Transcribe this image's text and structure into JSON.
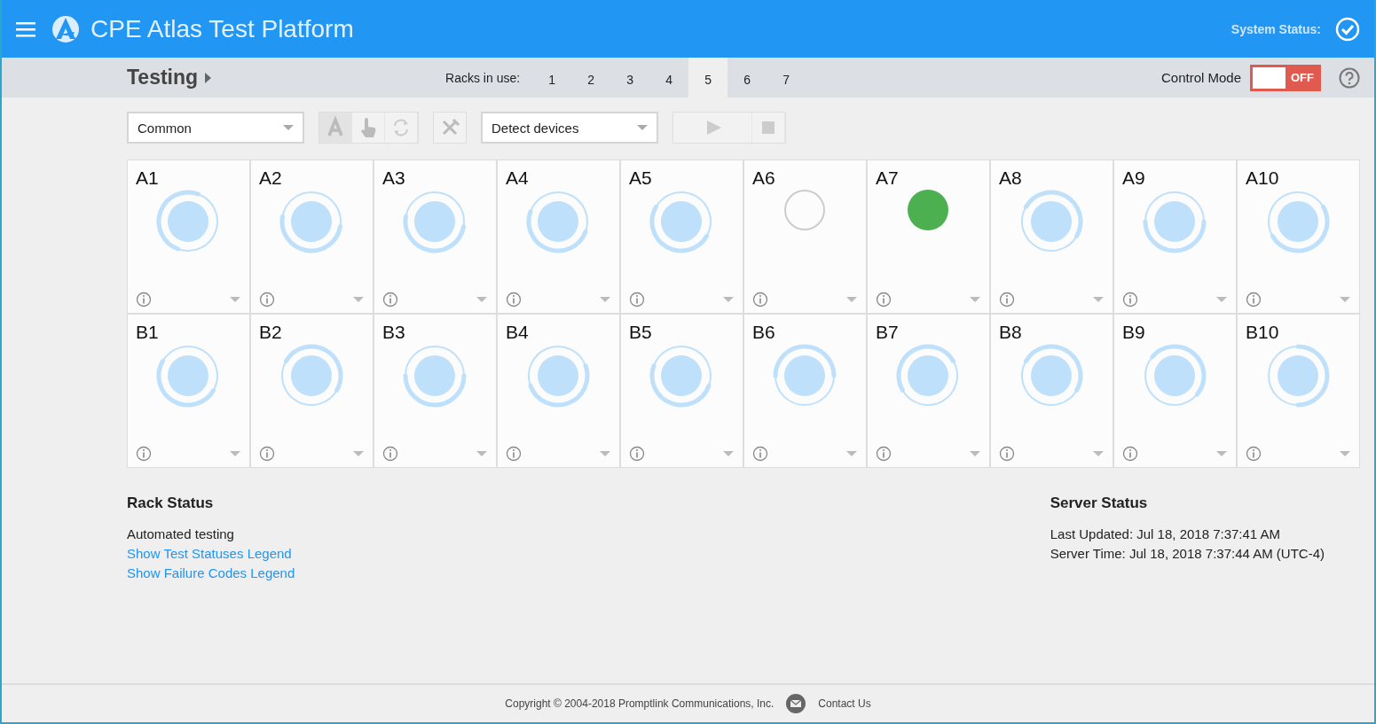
{
  "header": {
    "title": "CPE Atlas Test Platform",
    "system_status_label": "System Status:"
  },
  "subbar": {
    "title": "Testing",
    "racks_label": "Racks in use:",
    "racks": [
      {
        "label": "1",
        "selected": false
      },
      {
        "label": "2",
        "selected": false
      },
      {
        "label": "3",
        "selected": false
      },
      {
        "label": "4",
        "selected": false
      },
      {
        "label": "5",
        "selected": true
      },
      {
        "label": "6",
        "selected": false
      },
      {
        "label": "7",
        "selected": false
      }
    ],
    "control_mode": {
      "label": "Control Mode",
      "on": false,
      "state_text": "OFF"
    }
  },
  "toolbar": {
    "profile_select": {
      "value": "Common"
    },
    "action_select": {
      "value": "Detect devices"
    }
  },
  "slots": [
    {
      "label": "A1",
      "kind": "busy"
    },
    {
      "label": "A2",
      "kind": "busy"
    },
    {
      "label": "A3",
      "kind": "busy"
    },
    {
      "label": "A4",
      "kind": "busy"
    },
    {
      "label": "A5",
      "kind": "busy"
    },
    {
      "label": "A6",
      "kind": "idle"
    },
    {
      "label": "A7",
      "kind": "pass"
    },
    {
      "label": "A8",
      "kind": "busy"
    },
    {
      "label": "A9",
      "kind": "busy"
    },
    {
      "label": "A10",
      "kind": "busy"
    },
    {
      "label": "B1",
      "kind": "busy"
    },
    {
      "label": "B2",
      "kind": "busy"
    },
    {
      "label": "B3",
      "kind": "busy"
    },
    {
      "label": "B4",
      "kind": "busy"
    },
    {
      "label": "B5",
      "kind": "busy"
    },
    {
      "label": "B6",
      "kind": "busy"
    },
    {
      "label": "B7",
      "kind": "busy"
    },
    {
      "label": "B8",
      "kind": "busy"
    },
    {
      "label": "B9",
      "kind": "busy"
    },
    {
      "label": "B10",
      "kind": "busy"
    }
  ],
  "rack_status": {
    "heading": "Rack Status",
    "text": "Automated testing",
    "links": [
      "Show Test Statuses Legend",
      "Show Failure Codes Legend"
    ]
  },
  "server_status": {
    "heading": "Server Status",
    "lines": [
      "Last Updated: Jul 18, 2018 7:37:41 AM",
      "Server Time: Jul 18, 2018 7:37:44 AM (UTC-4)"
    ]
  },
  "footer": {
    "copyright": "Copyright © 2004-2018 Promptlink Communications, Inc.",
    "contact": "Contact Us"
  }
}
